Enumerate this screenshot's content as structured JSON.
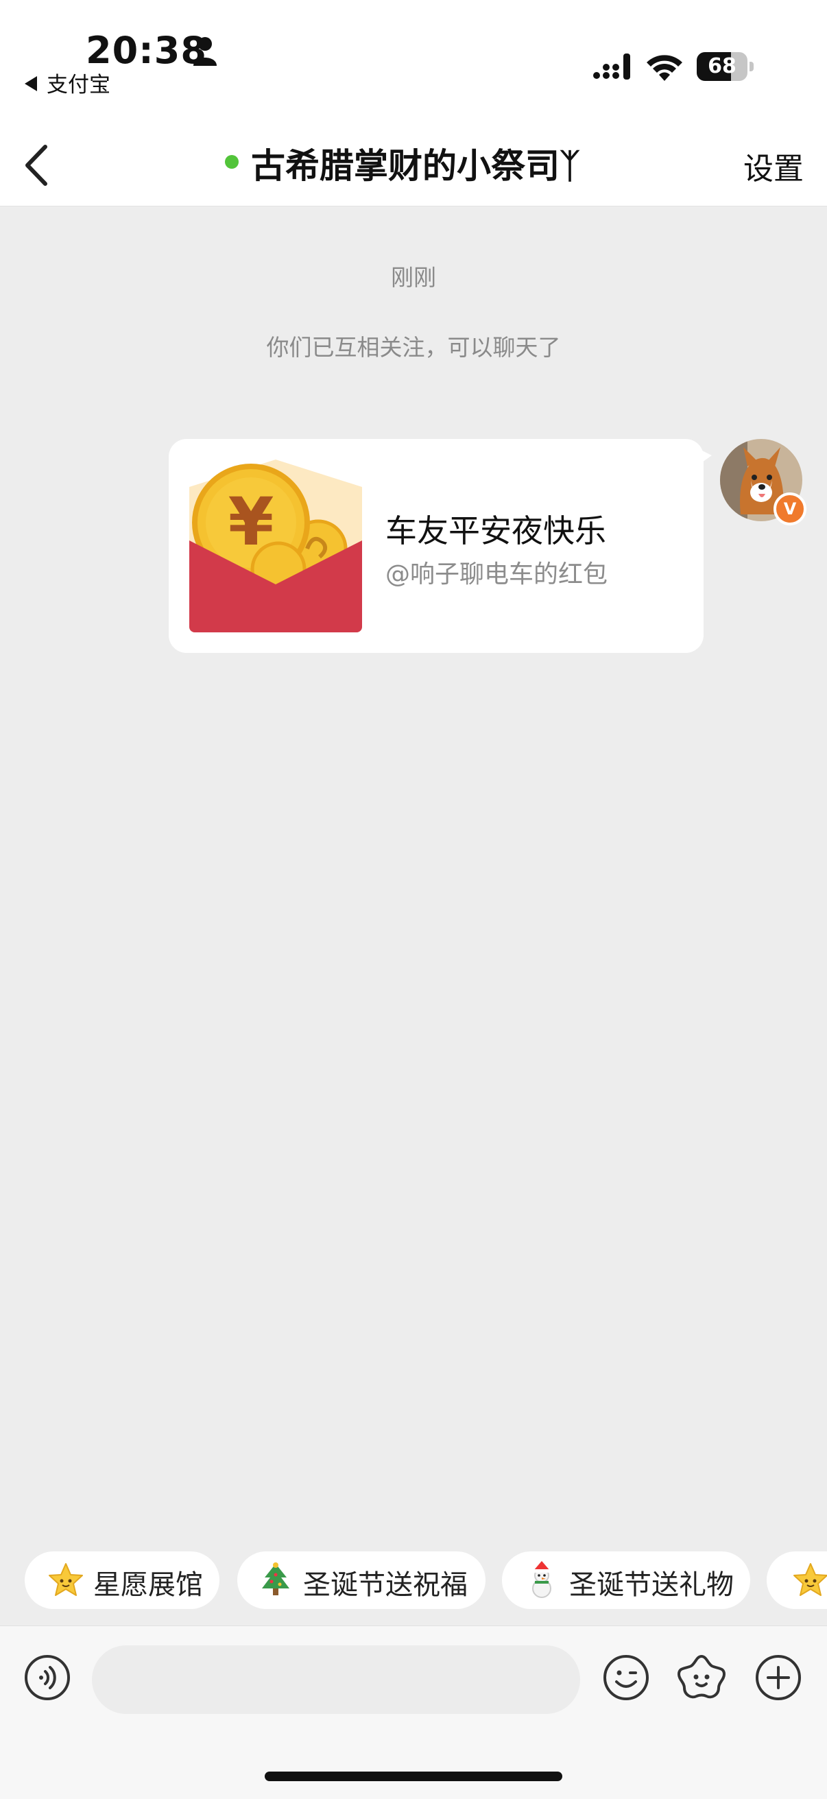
{
  "status_bar": {
    "time": "20:38",
    "back_app": "支付宝",
    "battery": "68",
    "battery_level": 0.68
  },
  "nav": {
    "title": "古希腊掌财的小祭司ᛉ",
    "settings": "设置",
    "online_color": "#52c43a"
  },
  "chat": {
    "timestamp": "刚刚",
    "system_message": "你们已互相关注，可以聊天了",
    "red_packet": {
      "title": "车友平安夜快乐",
      "subtitle": "@响子聊电车的红包"
    },
    "avatar_badge": "V"
  },
  "quick_replies": [
    {
      "label": "星愿展馆",
      "icon": "star-face-icon"
    },
    {
      "label": "圣诞节送祝福",
      "icon": "christmas-tree-icon"
    },
    {
      "label": "圣诞节送礼物",
      "icon": "snowman-icon"
    },
    {
      "label": "",
      "icon": "star-face-icon"
    }
  ],
  "input": {
    "placeholder": ""
  },
  "colors": {
    "background": "#ededed",
    "accent_orange": "#f07a2c",
    "packet_red": "#d23a4a",
    "coin_gold": "#f5c230"
  }
}
